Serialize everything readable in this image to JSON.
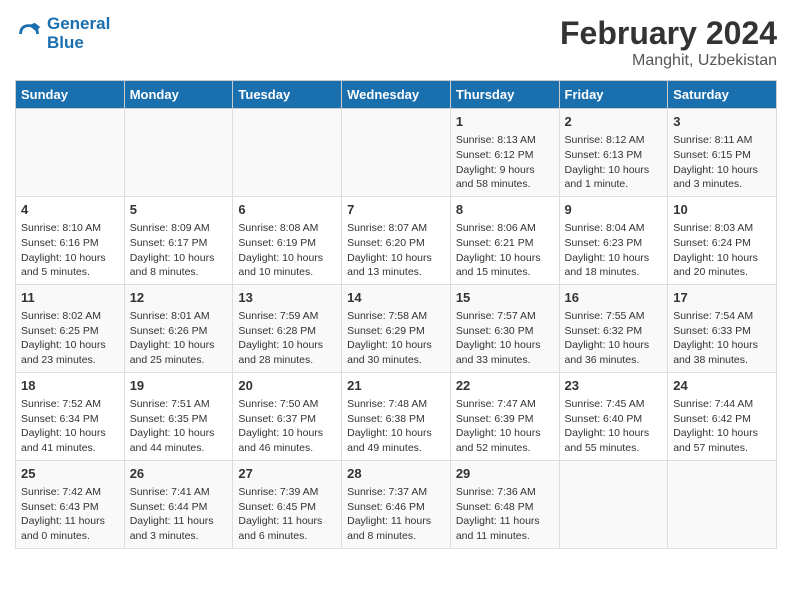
{
  "header": {
    "logo_line1": "General",
    "logo_line2": "Blue",
    "title": "February 2024",
    "subtitle": "Manghit, Uzbekistan"
  },
  "weekdays": [
    "Sunday",
    "Monday",
    "Tuesday",
    "Wednesday",
    "Thursday",
    "Friday",
    "Saturday"
  ],
  "weeks": [
    [
      {
        "day": "",
        "info": ""
      },
      {
        "day": "",
        "info": ""
      },
      {
        "day": "",
        "info": ""
      },
      {
        "day": "",
        "info": ""
      },
      {
        "day": "1",
        "info": "Sunrise: 8:13 AM\nSunset: 6:12 PM\nDaylight: 9 hours and 58 minutes."
      },
      {
        "day": "2",
        "info": "Sunrise: 8:12 AM\nSunset: 6:13 PM\nDaylight: 10 hours and 1 minute."
      },
      {
        "day": "3",
        "info": "Sunrise: 8:11 AM\nSunset: 6:15 PM\nDaylight: 10 hours and 3 minutes."
      }
    ],
    [
      {
        "day": "4",
        "info": "Sunrise: 8:10 AM\nSunset: 6:16 PM\nDaylight: 10 hours and 5 minutes."
      },
      {
        "day": "5",
        "info": "Sunrise: 8:09 AM\nSunset: 6:17 PM\nDaylight: 10 hours and 8 minutes."
      },
      {
        "day": "6",
        "info": "Sunrise: 8:08 AM\nSunset: 6:19 PM\nDaylight: 10 hours and 10 minutes."
      },
      {
        "day": "7",
        "info": "Sunrise: 8:07 AM\nSunset: 6:20 PM\nDaylight: 10 hours and 13 minutes."
      },
      {
        "day": "8",
        "info": "Sunrise: 8:06 AM\nSunset: 6:21 PM\nDaylight: 10 hours and 15 minutes."
      },
      {
        "day": "9",
        "info": "Sunrise: 8:04 AM\nSunset: 6:23 PM\nDaylight: 10 hours and 18 minutes."
      },
      {
        "day": "10",
        "info": "Sunrise: 8:03 AM\nSunset: 6:24 PM\nDaylight: 10 hours and 20 minutes."
      }
    ],
    [
      {
        "day": "11",
        "info": "Sunrise: 8:02 AM\nSunset: 6:25 PM\nDaylight: 10 hours and 23 minutes."
      },
      {
        "day": "12",
        "info": "Sunrise: 8:01 AM\nSunset: 6:26 PM\nDaylight: 10 hours and 25 minutes."
      },
      {
        "day": "13",
        "info": "Sunrise: 7:59 AM\nSunset: 6:28 PM\nDaylight: 10 hours and 28 minutes."
      },
      {
        "day": "14",
        "info": "Sunrise: 7:58 AM\nSunset: 6:29 PM\nDaylight: 10 hours and 30 minutes."
      },
      {
        "day": "15",
        "info": "Sunrise: 7:57 AM\nSunset: 6:30 PM\nDaylight: 10 hours and 33 minutes."
      },
      {
        "day": "16",
        "info": "Sunrise: 7:55 AM\nSunset: 6:32 PM\nDaylight: 10 hours and 36 minutes."
      },
      {
        "day": "17",
        "info": "Sunrise: 7:54 AM\nSunset: 6:33 PM\nDaylight: 10 hours and 38 minutes."
      }
    ],
    [
      {
        "day": "18",
        "info": "Sunrise: 7:52 AM\nSunset: 6:34 PM\nDaylight: 10 hours and 41 minutes."
      },
      {
        "day": "19",
        "info": "Sunrise: 7:51 AM\nSunset: 6:35 PM\nDaylight: 10 hours and 44 minutes."
      },
      {
        "day": "20",
        "info": "Sunrise: 7:50 AM\nSunset: 6:37 PM\nDaylight: 10 hours and 46 minutes."
      },
      {
        "day": "21",
        "info": "Sunrise: 7:48 AM\nSunset: 6:38 PM\nDaylight: 10 hours and 49 minutes."
      },
      {
        "day": "22",
        "info": "Sunrise: 7:47 AM\nSunset: 6:39 PM\nDaylight: 10 hours and 52 minutes."
      },
      {
        "day": "23",
        "info": "Sunrise: 7:45 AM\nSunset: 6:40 PM\nDaylight: 10 hours and 55 minutes."
      },
      {
        "day": "24",
        "info": "Sunrise: 7:44 AM\nSunset: 6:42 PM\nDaylight: 10 hours and 57 minutes."
      }
    ],
    [
      {
        "day": "25",
        "info": "Sunrise: 7:42 AM\nSunset: 6:43 PM\nDaylight: 11 hours and 0 minutes."
      },
      {
        "day": "26",
        "info": "Sunrise: 7:41 AM\nSunset: 6:44 PM\nDaylight: 11 hours and 3 minutes."
      },
      {
        "day": "27",
        "info": "Sunrise: 7:39 AM\nSunset: 6:45 PM\nDaylight: 11 hours and 6 minutes."
      },
      {
        "day": "28",
        "info": "Sunrise: 7:37 AM\nSunset: 6:46 PM\nDaylight: 11 hours and 8 minutes."
      },
      {
        "day": "29",
        "info": "Sunrise: 7:36 AM\nSunset: 6:48 PM\nDaylight: 11 hours and 11 minutes."
      },
      {
        "day": "",
        "info": ""
      },
      {
        "day": "",
        "info": ""
      }
    ]
  ]
}
